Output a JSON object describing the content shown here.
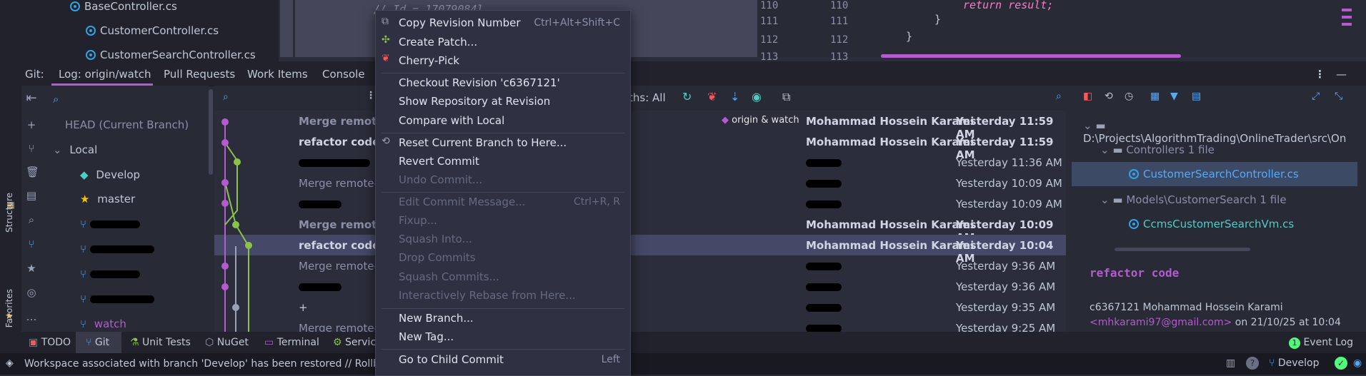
{
  "project_tree": {
    "files": [
      "BaseController.cs",
      "CustomerController.cs",
      "CustomerSearchController.cs"
    ]
  },
  "editor": {
    "left_lines": [
      {
        "num": "110",
        "code": "//            Id = 17079084l,"
      },
      {
        "num": "111",
        "code": ""
      },
      {
        "num": "112",
        "code": ""
      },
      {
        "num": "113",
        "code": ""
      }
    ],
    "right_lines": [
      {
        "num": "110",
        "code": "return result;"
      },
      {
        "num": "111",
        "code": "}"
      },
      {
        "num": "112",
        "code": "}"
      },
      {
        "num": "113",
        "code": ""
      }
    ],
    "partial_right_1": "\",",
    "partial_right_2": "\","
  },
  "git_tabs": {
    "prefix": "Git:",
    "tabs": [
      "Log: origin/watch",
      "Pull Requests",
      "Work Items",
      "Console"
    ]
  },
  "branches": {
    "head": "HEAD (Current Branch)",
    "local_label": "Local",
    "items": [
      "Develop",
      "master",
      "",
      "",
      "",
      "",
      "watch"
    ]
  },
  "log_toolbar": {
    "paths_filter": "ths: All"
  },
  "log_rows": [
    {
      "subject": "Merge remote-",
      "author": "Mohammad Hossein Karami",
      "date": "Yesterday 11:59 AM",
      "bold": true,
      "dim": true,
      "tag": "origin & watch"
    },
    {
      "subject": "refactor code",
      "author": "Mohammad Hossein Karami",
      "date": "Yesterday 11:59 AM",
      "bold": true
    },
    {
      "subject": "",
      "author": "",
      "date": "Yesterday 11:36 AM"
    },
    {
      "subject": "Merge remote-t",
      "author": "",
      "date": "Yesterday 10:09 AM",
      "dim": true
    },
    {
      "subject": "",
      "author": "",
      "date": "Yesterday 10:09 AM"
    },
    {
      "subject": "Merge remote-",
      "author": "Mohammad Hossein Karami",
      "date": "Yesterday 10:09 AM",
      "bold": true,
      "dim": true
    },
    {
      "subject": "refactor code",
      "author": "Mohammad Hossein Karami",
      "date": "Yesterday 10:04 AM",
      "bold": true,
      "selected": true
    },
    {
      "subject": "Merge remote-t",
      "author": "",
      "date": "Yesterday 9:36 AM",
      "dim": true
    },
    {
      "subject": "",
      "author": "",
      "date": "Yesterday 9:36 AM"
    },
    {
      "subject": "+",
      "author": "",
      "date": "Yesterday 9:35 AM"
    },
    {
      "subject": "Merge remote-t",
      "author": "",
      "date": "Yesterday 9:25 AM",
      "dim": true
    }
  ],
  "details": {
    "path": "D:\\Projects\\AlgorithmTrading\\OnlineTrader\\src\\On",
    "folder1": "Controllers",
    "folder1_count": "1 file",
    "file1": "CustomerSearchController.cs",
    "folder2": "Models\\CustomerSearch",
    "folder2_count": "1 file",
    "file2": "CcmsCustomerSearchVm.cs",
    "commit_title": "refactor code",
    "commit_hash_author": "c6367121 Mohammad Hossein Karami",
    "email": "<mhkarami97@gmail.com>",
    "date_suffix": "on 21/10/25 at 10:04"
  },
  "context_menu": {
    "items": [
      {
        "label": "Copy Revision Number",
        "shortcut": "Ctrl+Alt+Shift+C",
        "icon": "copy-icon"
      },
      {
        "label": "Create Patch...",
        "icon": "patch-icon"
      },
      {
        "label": "Cherry-Pick",
        "icon": "cherry-icon"
      },
      {
        "label": "Checkout Revision 'c6367121'"
      },
      {
        "label": "Show Repository at Revision"
      },
      {
        "label": "Compare with Local"
      },
      {
        "label": "Reset Current Branch to Here...",
        "icon": "reset-icon"
      },
      {
        "label": "Revert Commit"
      },
      {
        "label": "Undo Commit...",
        "disabled": true
      },
      {
        "label": "Edit Commit Message...",
        "shortcut": "Ctrl+R, R",
        "disabled": true
      },
      {
        "label": "Fixup...",
        "disabled": true
      },
      {
        "label": "Squash Into...",
        "disabled": true
      },
      {
        "label": "Drop Commits",
        "disabled": true
      },
      {
        "label": "Squash Commits...",
        "disabled": true
      },
      {
        "label": "Interactively Rebase from Here...",
        "disabled": true
      },
      {
        "label": "New Branch..."
      },
      {
        "label": "New Tag..."
      },
      {
        "label": "Go to Child Commit",
        "shortcut": "Left"
      }
    ]
  },
  "bottom_tools": [
    "TODO",
    "Git",
    "Unit Tests",
    "NuGet",
    "Terminal",
    "Service"
  ],
  "side_labels": {
    "structure": "Structure",
    "favorites": "Favorites"
  },
  "event_log": {
    "count": "1",
    "label": "Event Log"
  },
  "status": {
    "message": "Workspace associated with branch 'Develop' has been restored // Rollback",
    "branch": "Develop"
  },
  "colors": {
    "accent": "#b45bcf",
    "background": "#282a36",
    "selection": "#454866"
  }
}
